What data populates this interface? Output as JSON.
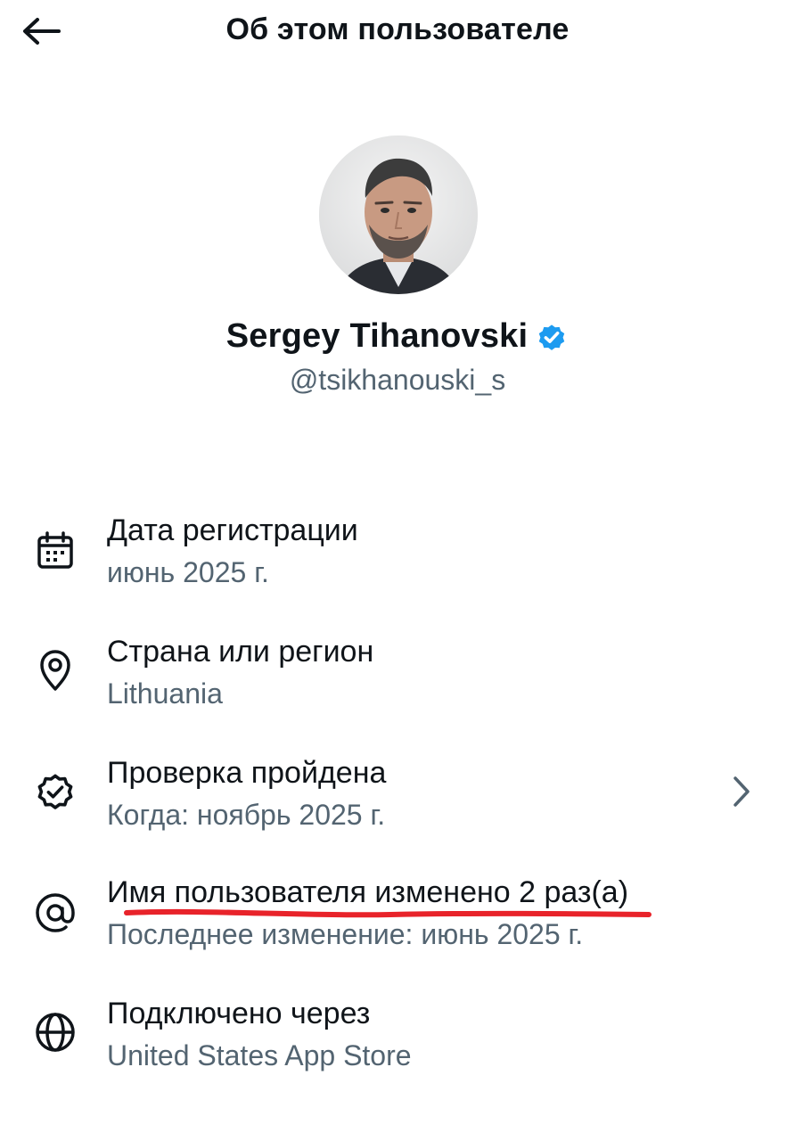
{
  "header": {
    "title": "Об этом пользователе",
    "back_icon": "arrow-left-icon"
  },
  "profile": {
    "name": "Sergey Tihanovski",
    "handle": "@tsikhanouski_s",
    "verified": true,
    "verified_color": "#1d9bf0"
  },
  "info": [
    {
      "icon": "calendar-icon",
      "title": "Дата регистрации",
      "value": "июнь 2025 г."
    },
    {
      "icon": "location-pin-icon",
      "title": "Страна или регион",
      "value": "Lithuania"
    },
    {
      "icon": "verified-check-icon",
      "title": "Проверка пройдена",
      "value": "Когда: ноябрь 2025 г."
    },
    {
      "icon": "at-sign-icon",
      "title": "Имя пользователя изменено 2 раз(а)",
      "value": "Последнее изменение: июнь 2025 г."
    },
    {
      "icon": "globe-icon",
      "title": "Подключено через",
      "value": "United States App Store"
    }
  ],
  "colors": {
    "primary_text": "#0f1419",
    "secondary_text": "#536471",
    "annotation": "#e8232a"
  }
}
